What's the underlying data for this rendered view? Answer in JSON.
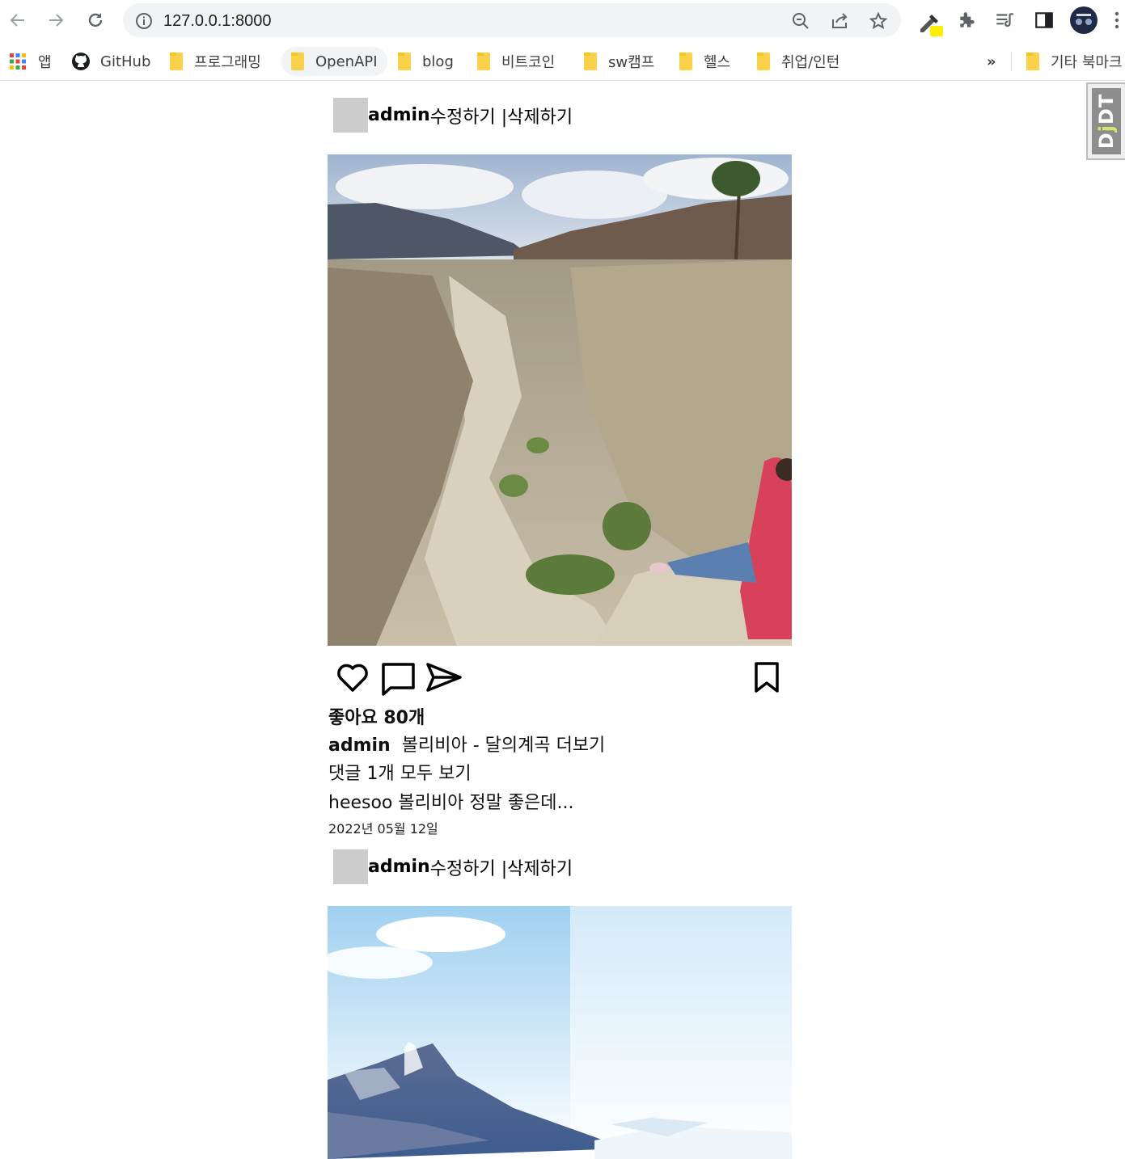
{
  "browser": {
    "url": "127.0.0.1:8000",
    "bookmarks": [
      {
        "label": "앱",
        "icon": "apps-grid-icon"
      },
      {
        "label": "GitHub",
        "icon": "github-icon"
      },
      {
        "label": "프로그래밍",
        "icon": "folder-icon"
      },
      {
        "label": "OpenAPI",
        "icon": "folder-icon"
      },
      {
        "label": "blog",
        "icon": "folder-icon"
      },
      {
        "label": "비트코인",
        "icon": "folder-icon"
      },
      {
        "label": "sw캠프",
        "icon": "folder-icon"
      },
      {
        "label": "헬스",
        "icon": "folder-icon"
      },
      {
        "label": "취업/인턴",
        "icon": "folder-icon"
      }
    ],
    "overflow": "»",
    "other_bookmarks": "기타 북마크"
  },
  "djdt": {
    "label_d": "D",
    "label_j": "j",
    "label_dt": "DT"
  },
  "posts": [
    {
      "author": "admin",
      "edit_label": " 수정하기 |",
      "delete_label": "삭제하기",
      "likes": "좋아요 80개",
      "caption_author": "admin",
      "caption_text": "볼리비아 - 달의계곡 더보기",
      "comments_link": "댓글 1개 모두 보기",
      "comment": "heesoo 볼리비아 정말 좋은데...",
      "date": "2022년 05월 12일"
    },
    {
      "author": "admin",
      "edit_label": " 수정하기 |",
      "delete_label": "삭제하기"
    }
  ],
  "colors": {
    "accent_yellow": "#f9d14a",
    "chrome_bg": "#f1f3f4"
  }
}
